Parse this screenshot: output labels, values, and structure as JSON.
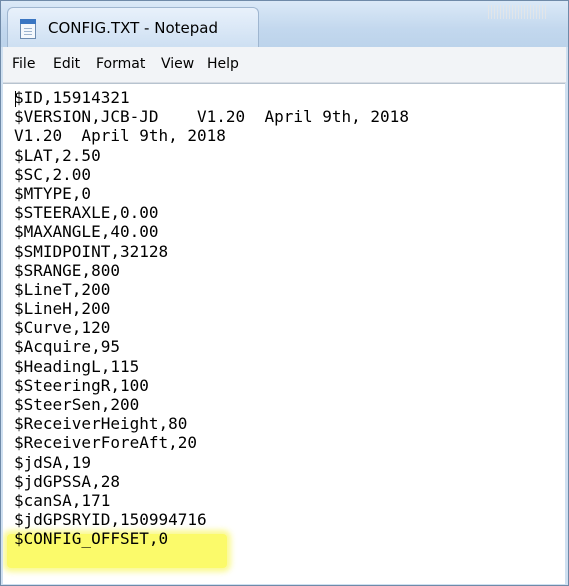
{
  "window": {
    "title": "CONFIG.TXT - Notepad"
  },
  "menu": {
    "items": [
      "File",
      "Edit",
      "Format",
      "View",
      "Help"
    ]
  },
  "editor": {
    "lines": [
      "$ID,15914321",
      "$VERSION,JCB-JD    V1.20  April 9th, 2018",
      "V1.20  April 9th, 2018",
      "$LAT,2.50",
      "$SC,2.00",
      "$MTYPE,0",
      "$STEERAXLE,0.00",
      "$MAXANGLE,40.00",
      "$SMIDPOINT,32128",
      "$SRANGE,800",
      "$LineT,200",
      "$LineH,200",
      "$Curve,120",
      "$Acquire,95",
      "$HeadingL,115",
      "$SteeringR,100",
      "$SteerSen,200",
      "$ReceiverHeight,80",
      "$ReceiverForeAft,20",
      "$jdSA,19",
      "$jdGPSSA,28",
      "$canSA,171",
      "$jdGPSRYID,150994716",
      "$CONFIG_OFFSET,0"
    ],
    "highlighted_line": "$CONFIG_OFFSET,0"
  },
  "colors": {
    "highlight": "#fbfa6a",
    "titlebar": "#c3d8ee",
    "menubar": "#f2f4f7"
  },
  "icons": {
    "app": "notepad-icon"
  }
}
